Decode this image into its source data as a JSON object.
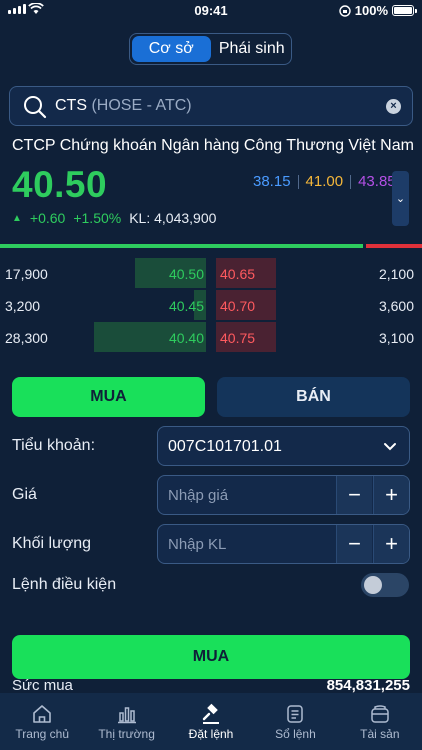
{
  "status": {
    "time": "09:41",
    "battery": "100%"
  },
  "segment": {
    "items": [
      "Cơ sở",
      "Phái sinh"
    ],
    "active": 0
  },
  "search": {
    "symbol": "CTS",
    "exchange": "(HOSE - ATC)"
  },
  "stock": {
    "company": "CTCP Chứng khoán Ngân hàng Công Thương Việt Nam",
    "price": "40.50",
    "change": "+0.60",
    "change_pct": "+1.50%",
    "volume": "KL: 4,043,900",
    "ref_prices": [
      "38.15",
      "41.00",
      "43.85"
    ],
    "colors": {
      "up": "#2ecc5e",
      "ref": "#4a9bff",
      "ceiling": "#b450e6",
      "floor": "#ffa500"
    }
  },
  "order_book": {
    "bid_share": 0.86,
    "rows": [
      {
        "bid_qty": "17,900",
        "bid_price": "40.50",
        "ask_price": "40.65",
        "ask_qty": "2,100",
        "bid_depth": 0.63,
        "ask_depth": 0.2
      },
      {
        "bid_qty": "3,200",
        "bid_price": "40.45",
        "ask_price": "40.70",
        "ask_qty": "3,600",
        "bid_depth": 0.11,
        "ask_depth": 0.35
      },
      {
        "bid_qty": "28,300",
        "bid_price": "40.40",
        "ask_price": "40.75",
        "ask_qty": "3,100",
        "bid_depth": 1.0,
        "ask_depth": 0.3
      }
    ]
  },
  "trade": {
    "buy_tab": "MUA",
    "sell_tab": "BÁN",
    "account_label": "Tiểu khoản:",
    "account_value": "007C101701.01",
    "price_label": "Giá",
    "price_placeholder": "Nhập giá",
    "qty_label": "Khối lượng",
    "qty_placeholder": "Nhập KL",
    "condition_label": "Lệnh điều kiện",
    "submit": "MUA",
    "power_label": "Sức mua",
    "power_value": "854,831,255"
  },
  "tabbar": [
    {
      "label": "Trang chủ",
      "icon": "home-icon"
    },
    {
      "label": "Thị trường",
      "icon": "chart-icon"
    },
    {
      "label": "Đặt lệnh",
      "icon": "hammer-icon"
    },
    {
      "label": "Sổ lệnh",
      "icon": "list-icon"
    },
    {
      "label": "Tài sản",
      "icon": "wallet-icon"
    }
  ]
}
